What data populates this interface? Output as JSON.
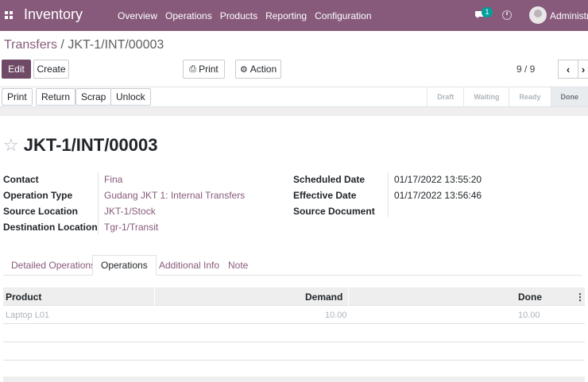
{
  "navbar": {
    "app_name": "Inventory",
    "menu": [
      "Overview",
      "Operations",
      "Products",
      "Reporting",
      "Configuration"
    ],
    "chat_badge": "1",
    "user_name": "Administrat",
    "bg_color": "#875a7b"
  },
  "breadcrumb": {
    "parent": "Transfers",
    "separator": " / ",
    "current": "JKT-1/INT/00003"
  },
  "toolbar": {
    "edit": "Edit",
    "create": "Create",
    "print": "Print",
    "action": "Action"
  },
  "pager": {
    "text": "9 / 9"
  },
  "statusbar": {
    "buttons": [
      "Print",
      "Return",
      "Scrap",
      "Unlock"
    ],
    "stages": [
      "Draft",
      "Waiting",
      "Ready",
      "Done"
    ],
    "active_stage": "Done"
  },
  "record": {
    "title": "JKT-1/INT/00003",
    "left_fields": [
      {
        "label": "Contact",
        "value": "Fina"
      },
      {
        "label": "Operation Type",
        "value": "Gudang JKT 1: Internal Transfers"
      },
      {
        "label": "Source Location",
        "value": "JKT-1/Stock"
      },
      {
        "label": "Destination Location",
        "value": "Tgr-1/Transit"
      }
    ],
    "right_fields": [
      {
        "label": "Scheduled Date",
        "value": "01/17/2022 13:55:20"
      },
      {
        "label": "Effective Date",
        "value": "01/17/2022 13:56:46"
      },
      {
        "label": "Source Document",
        "value": ""
      }
    ]
  },
  "tabs": [
    "Detailed Operations",
    "Operations",
    "Additional Info",
    "Note"
  ],
  "active_tab": "Operations",
  "table": {
    "headers": [
      "Product",
      "Demand",
      "Done"
    ],
    "rows": [
      {
        "product": "Laptop L01",
        "demand": "10.00",
        "done": "10.00"
      }
    ]
  }
}
